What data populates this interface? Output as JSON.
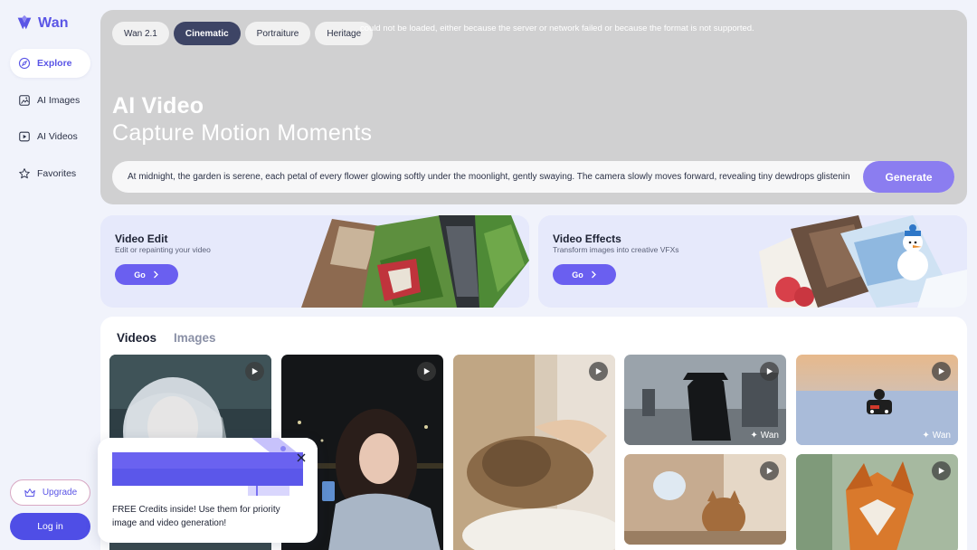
{
  "brand": {
    "name": "Wan",
    "accent": "#5a55e6"
  },
  "sidebar": {
    "items": [
      {
        "label": "Explore",
        "icon": "compass-icon",
        "active": true
      },
      {
        "label": "AI Images",
        "icon": "image-icon",
        "active": false
      },
      {
        "label": "AI Videos",
        "icon": "video-icon",
        "active": false
      },
      {
        "label": "Favorites",
        "icon": "star-icon",
        "active": false
      }
    ],
    "upgrade_label": "Upgrade",
    "login_label": "Log in"
  },
  "hero": {
    "tabs": [
      {
        "label": "Wan 2.1",
        "active": false
      },
      {
        "label": "Cinematic",
        "active": true
      },
      {
        "label": "Portraiture",
        "active": false
      },
      {
        "label": "Heritage",
        "active": false
      }
    ],
    "error_text": "could not be loaded, either because the server or network failed or because the format is not supported.",
    "title": "AI Video",
    "subtitle": "Capture Motion Moments",
    "prompt": "At midnight, the garden is serene, each petal of every flower glowing softly under the moonlight, gently swaying. The camera slowly moves forward, revealing tiny dewdrops glistening on the petals.",
    "generate_label": "Generate"
  },
  "features": [
    {
      "title": "Video Edit",
      "subtitle": "Edit or repainting your video",
      "go_label": "Go"
    },
    {
      "title": "Video Effects",
      "subtitle": "Transform images into creative VFXs",
      "go_label": "Go"
    }
  ],
  "gallery": {
    "tabs": [
      {
        "label": "Videos",
        "active": true
      },
      {
        "label": "Images",
        "active": false
      }
    ],
    "watermark": "Wan"
  },
  "popup": {
    "text": "FREE Credits inside! Use them for priority image and video generation!"
  }
}
